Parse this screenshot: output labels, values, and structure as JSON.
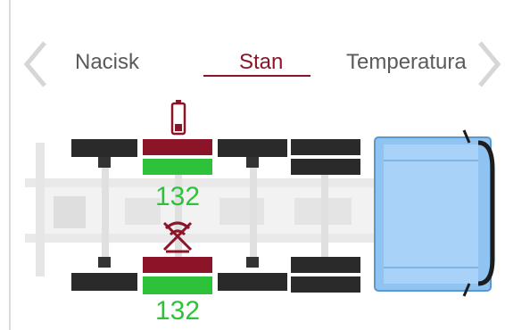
{
  "tabs": {
    "items": [
      {
        "label": "Nacisk"
      },
      {
        "label": "Stan"
      },
      {
        "label": "Temperatura"
      }
    ],
    "active_index": 1
  },
  "tires": {
    "top_left_drive": {
      "pressure": "132",
      "status": "alarm"
    },
    "bottom_left_drive": {
      "pressure": "132",
      "status": "alarm"
    }
  },
  "colors": {
    "active_tab": "#8c1428",
    "alarm_red": "#8c1428",
    "ok_green": "#2ec23a",
    "tire": "#2a2a2a",
    "cab_blue": "#8ec3f2"
  }
}
